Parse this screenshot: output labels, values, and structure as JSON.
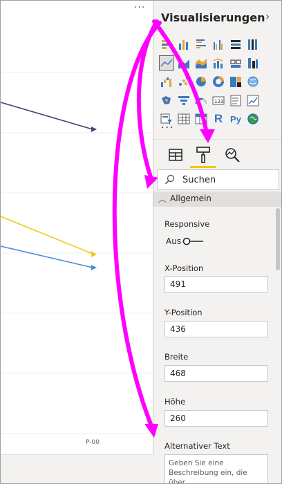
{
  "canvas": {
    "more_label": "···",
    "x_tick_label": "P-00",
    "line_colors": [
      "#3f4b6b",
      "#f2c811",
      "#4a8fd8"
    ]
  },
  "pane": {
    "title": "Visualisierungen",
    "chevron_icon": "chevron-right-icon",
    "more_label": "···",
    "viz_icons": [
      "stacked-bar-icon",
      "stacked-column-icon",
      "clustered-bar-icon",
      "clustered-column-icon",
      "100-stacked-bar-icon",
      "100-stacked-column-icon",
      "line-chart-icon",
      "area-chart-icon",
      "stacked-area-icon",
      "line-column-icon",
      "line-clustered-column-icon",
      "ribbon-chart-icon",
      "waterfall-icon",
      "scatter-icon",
      "pie-chart-icon",
      "donut-chart-icon",
      "treemap-icon",
      "map-icon",
      "filled-map-icon",
      "funnel-icon",
      "gauge-icon",
      "card-icon",
      "multi-row-card-icon",
      "kpi-icon",
      "slicer-icon",
      "table-icon",
      "matrix-icon",
      "r-visual-icon",
      "python-visual-icon",
      "globe-icon"
    ],
    "tabs": {
      "fields_icon": "fields-icon",
      "format_icon": "paint-roller-icon",
      "analytics_icon": "analytics-icon"
    },
    "search": {
      "label": "Suchen"
    },
    "section": {
      "label": "Allgemein"
    },
    "responsive": {
      "label": "Responsive",
      "toggle_text": "Aus",
      "state": "off"
    },
    "x_position": {
      "label": "X-Position",
      "value": "491"
    },
    "y_position": {
      "label": "Y-Position",
      "value": "436"
    },
    "width": {
      "label": "Breite",
      "value": "468"
    },
    "height": {
      "label": "Höhe",
      "value": "260"
    },
    "alt_text": {
      "label": "Alternativer Text",
      "placeholder": "Geben Sie eine Beschreibung ein, die über"
    }
  },
  "colors": {
    "accent_yellow": "#f2c811",
    "annotation_magenta": "#ff00ff",
    "pane_background": "#f3f2f1"
  }
}
